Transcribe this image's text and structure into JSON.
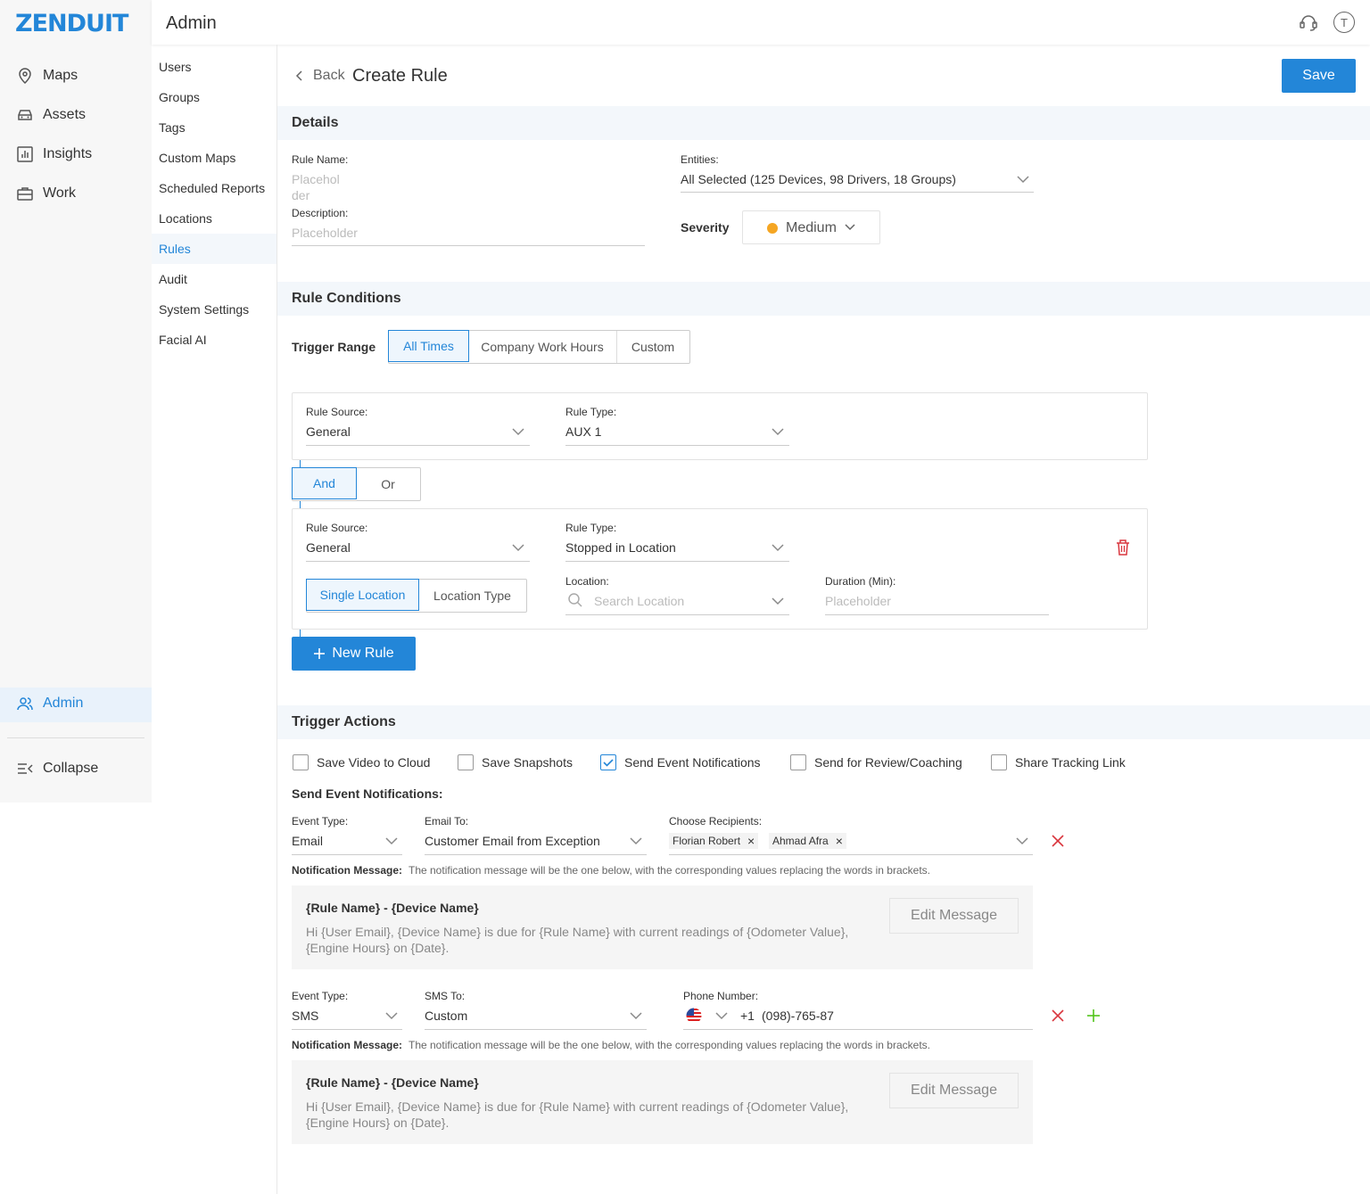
{
  "brand": {
    "logo": "ZENDUIT"
  },
  "header": {
    "section_title": "Admin"
  },
  "nav": {
    "items": [
      {
        "label": "Maps",
        "icon": "map-pin-icon"
      },
      {
        "label": "Assets",
        "icon": "car-icon"
      },
      {
        "label": "Insights",
        "icon": "bar-chart-icon"
      },
      {
        "label": "Work",
        "icon": "briefcase-icon"
      }
    ],
    "admin": "Admin",
    "collapse": "Collapse"
  },
  "subnav": [
    "Users",
    "Groups",
    "Tags",
    "Custom Maps",
    "Scheduled Reports",
    "Locations",
    "Rules",
    "Audit",
    "System Settings",
    "Facial AI"
  ],
  "page": {
    "back": "Back",
    "title": "Create Rule",
    "save": "Save"
  },
  "details": {
    "heading": "Details",
    "rule_name_label": "Rule Name:",
    "rule_name_placeholder": "Placeholder",
    "description_label": "Description:",
    "description_placeholder": "Placeholder",
    "entities_label": "Entities:",
    "entities_value": "All Selected (125 Devices, 98 Drivers, 18 Groups)",
    "severity_label": "Severity",
    "severity_value": "Medium"
  },
  "conditions": {
    "heading": "Rule Conditions",
    "trigger_range_label": "Trigger Range",
    "trigger_range_options": [
      "All Times",
      "Company Work Hours",
      "Custom"
    ],
    "rule1": {
      "source_label": "Rule Source:",
      "source": "General",
      "type_label": "Rule Type:",
      "type": "AUX 1"
    },
    "logic": [
      "And",
      "Or"
    ],
    "rule2": {
      "source_label": "Rule Source:",
      "source": "General",
      "type_label": "Rule Type:",
      "type": "Stopped in Location",
      "location_modes": [
        "Single Location",
        "Location Type"
      ],
      "location_label": "Location:",
      "location_placeholder": "Search Location",
      "duration_label": "Duration (Min):",
      "duration_placeholder": "Placeholder"
    },
    "new_rule": "New Rule"
  },
  "actions": {
    "heading": "Trigger Actions",
    "checkboxes": [
      {
        "label": "Save Video to Cloud",
        "checked": false
      },
      {
        "label": "Save Snapshots",
        "checked": false
      },
      {
        "label": "Send Event Notifications",
        "checked": true
      },
      {
        "label": "Send for Review/Coaching",
        "checked": false
      },
      {
        "label": "Share Tracking Link",
        "checked": false
      }
    ],
    "notif_heading": "Send Event Notifications:",
    "email": {
      "event_type_label": "Event Type:",
      "event_type": "Email",
      "to_label": "Email To:",
      "to": "Customer Email from Exception",
      "recipients_label": "Choose Recipients:",
      "recipients": [
        "Florian Robert",
        "Ahmad Afra"
      ],
      "msg_label": "Notification Message:",
      "msg_hint": "The notification message will be the one below, with the corresponding values replacing the words in brackets.",
      "msg_title": "{Rule Name} - {Device Name}",
      "msg_body": "Hi {User Email}, {Device Name} is due for {Rule Name} with current readings of {Odometer Value}, {Engine Hours} on {Date}.",
      "edit": "Edit Message"
    },
    "sms": {
      "event_type_label": "Event Type:",
      "event_type": "SMS",
      "to_label": "SMS To:",
      "to": "Custom",
      "phone_label": "Phone Number:",
      "country_code": "+1",
      "phone": "(098)-765-87",
      "msg_label": "Notification Message:",
      "msg_hint": "The notification message will be the one below, with the corresponding values replacing the words in brackets.",
      "msg_title": "{Rule Name} - {Device Name}",
      "msg_body": "Hi {User Email}, {Device Name} is due for {Rule Name} with current readings of {Odometer Value}, {Engine Hours} on {Date}.",
      "edit": "Edit Message"
    }
  },
  "colors": {
    "accent": "#2386d8",
    "danger": "#d9363e",
    "success": "#52c41a",
    "severity_dot": "#f5a623"
  }
}
